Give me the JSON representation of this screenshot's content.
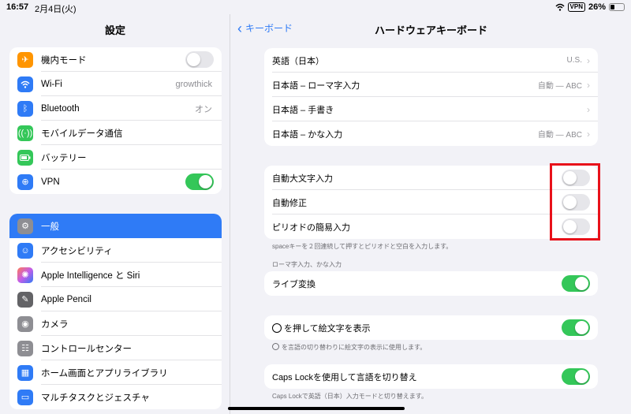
{
  "status": {
    "time": "16:57",
    "date": "2月4日(火)",
    "vpn": "VPN",
    "battery": "26%"
  },
  "sidebar": {
    "title": "設定",
    "group1": [
      {
        "label": "機内モード",
        "icon": "airplane-icon",
        "color": "#ff9500",
        "toggle": false
      },
      {
        "label": "Wi-Fi",
        "icon": "wifi-icon",
        "color": "#2f7bf6",
        "value": "growthick"
      },
      {
        "label": "Bluetooth",
        "icon": "bluetooth-icon",
        "color": "#2f7bf6",
        "value": "オン"
      },
      {
        "label": "モバイルデータ通信",
        "icon": "antenna-icon",
        "color": "#34c759"
      },
      {
        "label": "バッテリー",
        "icon": "battery-icon",
        "color": "#34c759"
      },
      {
        "label": "VPN",
        "icon": "vpn-icon",
        "color": "#2f7bf6",
        "toggle": true
      }
    ],
    "group2": [
      {
        "label": "一般",
        "icon": "gear-icon",
        "color": "#8e8e93",
        "selected": true
      },
      {
        "label": "アクセシビリティ",
        "icon": "accessibility-icon",
        "color": "#2f7bf6"
      },
      {
        "label": "Apple Intelligence と Siri",
        "icon": "siri-icon",
        "color": "#c35de8"
      },
      {
        "label": "Apple Pencil",
        "icon": "pencil-icon",
        "color": "#636366"
      },
      {
        "label": "カメラ",
        "icon": "camera-icon",
        "color": "#8e8e93"
      },
      {
        "label": "コントロールセンター",
        "icon": "control-center-icon",
        "color": "#8e8e93"
      },
      {
        "label": "ホーム画面とアプリライブラリ",
        "icon": "home-screen-icon",
        "color": "#2f7bf6"
      },
      {
        "label": "マルチタスクとジェスチャ",
        "icon": "multitask-icon",
        "color": "#2f7bf6"
      }
    ]
  },
  "nav": {
    "back_label": "キーボード",
    "title": "ハードウェアキーボード"
  },
  "layouts": [
    {
      "label": "英語（日本）",
      "value": "U.S."
    },
    {
      "label": "日本語 – ローマ字入力",
      "value": "自動 — ABC"
    },
    {
      "label": "日本語 – 手書き",
      "value": ""
    },
    {
      "label": "日本語 – かな入力",
      "value": "自動 — ABC"
    }
  ],
  "options": [
    {
      "label": "自動大文字入力",
      "toggle": false
    },
    {
      "label": "自動修正",
      "toggle": false
    },
    {
      "label": "ピリオドの簡易入力",
      "toggle": false
    }
  ],
  "notes": {
    "period": "spaceキーを２回連続して押すとピリオドと空白を入力します。",
    "section_romaji": "ローマ字入力、かな入力",
    "emoji": "を言語の切り替わりに絵文字の表示に使用します。",
    "capslock": "Caps Lockで英語（日本）入力モードと切り替えます。"
  },
  "live": {
    "label": "ライブ変換",
    "toggle": true
  },
  "emoji_row": {
    "label": "を押して絵文字を表示",
    "toggle": true
  },
  "capslock_row": {
    "label": "Caps Lockを使用して言語を切り替え",
    "toggle": true
  }
}
